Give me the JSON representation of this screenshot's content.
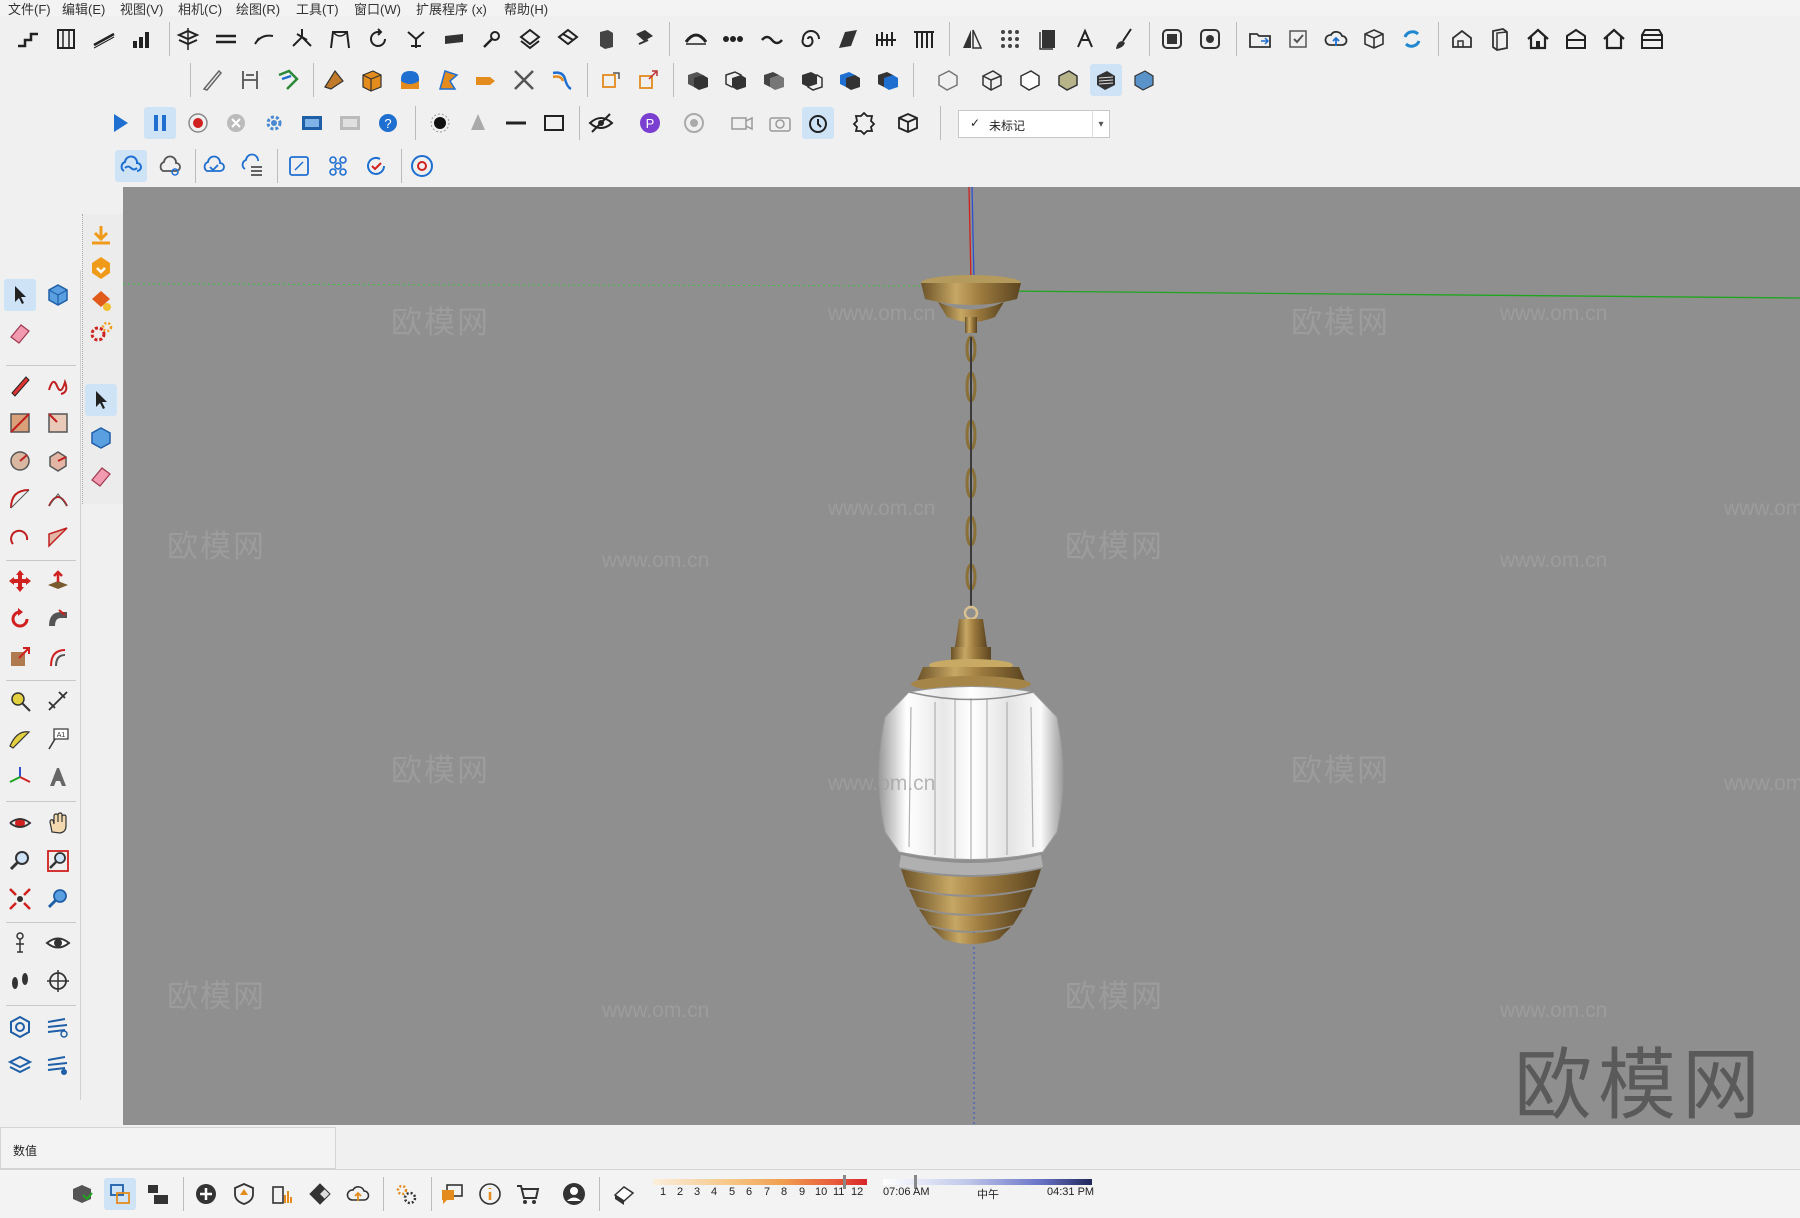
{
  "menu": [
    "文件(F)",
    "编辑(E)",
    "视图(V)",
    "相机(C)",
    "绘图(R)",
    "工具(T)",
    "窗口(W)",
    "扩展程序 (x)",
    "帮助(H)"
  ],
  "tag_selector": {
    "check": "✓",
    "value": "未标记"
  },
  "value_box": {
    "label": "数值",
    "value": ""
  },
  "watermarks": {
    "brand": "欧模网",
    "url": "www.om.cn",
    "big": "欧模网"
  },
  "shadow": {
    "months": [
      "1",
      "2",
      "3",
      "4",
      "5",
      "6",
      "7",
      "8",
      "9",
      "10",
      "11",
      "12"
    ],
    "time_start": "07:06 AM",
    "time_noon": "中午",
    "time_end": "04:31 PM",
    "time_scale_colors": [
      "#fbeedc",
      "#f7c88a",
      "#f0a050",
      "#e85a3a",
      "#d7262a"
    ]
  },
  "colors": {
    "viewport_bg": "#8f8f8f",
    "accent_blue": "#1f6fd1",
    "axis_green": "#1fa51f",
    "axis_red": "#d02020",
    "axis_blue": "#3050d0"
  }
}
